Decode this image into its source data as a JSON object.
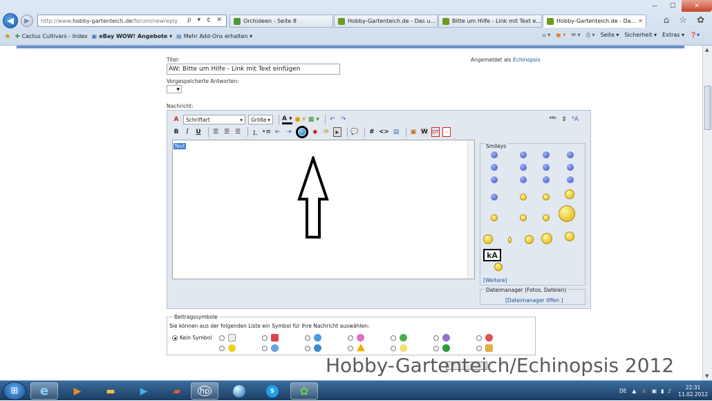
{
  "browser": {
    "address": {
      "prefix": "http://www.",
      "domain": "hobby-gartenteich.de",
      "path": "/forum/newreply",
      "tools": "ρ ▾ ¢ ✕"
    },
    "tabs": [
      {
        "label": "Orchideen - Seite 8",
        "icon_color": "#4a9a3a",
        "active": false
      },
      {
        "label": "Hobby-Gartenteich.de - Das u...",
        "icon_color": "#6b9a20",
        "active": false
      },
      {
        "label": "Bitte um Hilfe - Link mit Text e...",
        "icon_color": "#6b9a20",
        "active": false
      },
      {
        "label": "Hobby-Gartenteich.de - Da...",
        "icon_color": "#6b9a20",
        "active": true
      }
    ],
    "window_buttons": {
      "minimize": "—",
      "maximize": "☐",
      "close": "✕"
    },
    "right_tools": "⌂ ☆ ✿",
    "favorites": {
      "items": [
        {
          "label": "Cactus Cultivars - Index",
          "bold": false
        },
        {
          "label": "eBay WOW! Angebote ▾",
          "bold": true
        },
        {
          "label": "Mehr Add-Ons erhalten ▾",
          "bold": false
        }
      ],
      "tools": [
        "Seite ▾",
        "Sicherheit ▾",
        "Extras ▾"
      ]
    }
  },
  "form": {
    "title_label": "Titel:",
    "title_value": "AW: Bitte um Hilfe - Link mit Text einfügen",
    "saved_answers_label": "Vorgespeicherte Antworten:",
    "message_label": "Nachricht:",
    "logged_in_prefix": "Angemeldet als",
    "logged_in_user": "Echinopsis",
    "font_dropdown": "Schriftart",
    "size_dropdown": "Größe",
    "editor_text": "Test"
  },
  "smileys": {
    "legend": "Smileys",
    "more_link": "[Weitere]",
    "sign_text": "kA"
  },
  "file_manager": {
    "legend": "Dateimanager (Fotos, Dateien)",
    "link": "[Dateimanager öffen ]"
  },
  "post_icons": {
    "legend": "Beitragssymbole",
    "description": "Sie können aus der folgenden Liste ein Symbol für Ihre Nachricht auswählen:",
    "none_label": "Kein Symbol"
  },
  "watermark": "Hobby-Gartenteich/Echinopsis 2012",
  "taskbar": {
    "language": "DE",
    "time": "22:31",
    "date": "11.02.2012"
  },
  "colors": {
    "accent": "#1c4f9c",
    "selection": "#3a7bd5",
    "taskbar": "#1b3d63"
  }
}
